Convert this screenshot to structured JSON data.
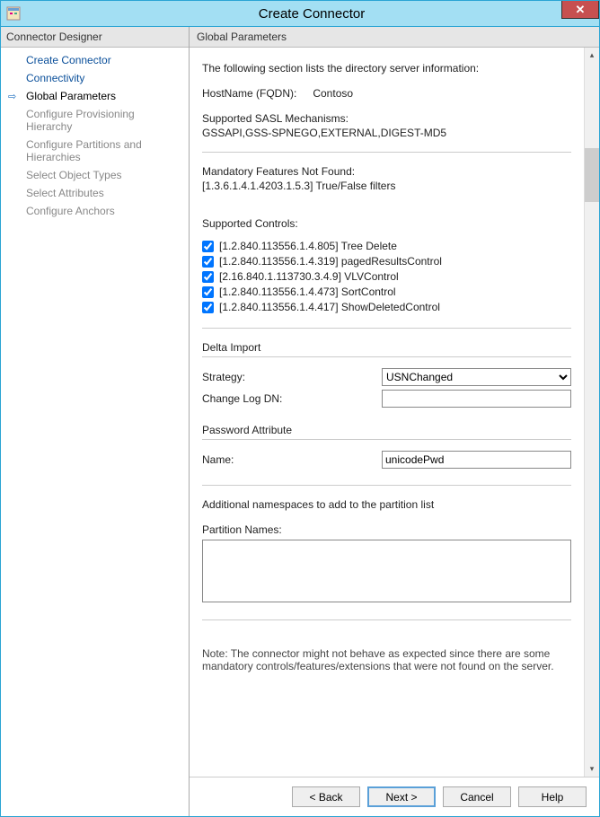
{
  "window": {
    "title": "Create Connector"
  },
  "sidebar": {
    "header": "Connector Designer",
    "items": [
      {
        "label": "Create Connector",
        "state": "enabled"
      },
      {
        "label": "Connectivity",
        "state": "enabled"
      },
      {
        "label": "Global Parameters",
        "state": "current"
      },
      {
        "label": "Configure Provisioning Hierarchy",
        "state": "disabled"
      },
      {
        "label": "Configure Partitions and Hierarchies",
        "state": "disabled"
      },
      {
        "label": "Select Object Types",
        "state": "disabled"
      },
      {
        "label": "Select Attributes",
        "state": "disabled"
      },
      {
        "label": "Configure Anchors",
        "state": "disabled"
      }
    ]
  },
  "main": {
    "header": "Global Parameters",
    "intro": "The following section lists the directory server information:",
    "hostname_label": "HostName (FQDN):",
    "hostname_value": "Contoso",
    "sasl_label": "Supported SASL Mechanisms:",
    "sasl_value": "GSSAPI,GSS-SPNEGO,EXTERNAL,DIGEST-MD5",
    "mandatory_label": "Mandatory Features Not Found:",
    "mandatory_value": "[1.3.6.1.4.1.4203.1.5.3] True/False filters",
    "controls_label": "Supported Controls:",
    "controls": [
      {
        "checked": true,
        "text": "[1.2.840.113556.1.4.805] Tree Delete"
      },
      {
        "checked": true,
        "text": "[1.2.840.113556.1.4.319] pagedResultsControl"
      },
      {
        "checked": true,
        "text": "[2.16.840.1.113730.3.4.9] VLVControl"
      },
      {
        "checked": true,
        "text": "[1.2.840.113556.1.4.473] SortControl"
      },
      {
        "checked": true,
        "text": "[1.2.840.113556.1.4.417] ShowDeletedControl"
      }
    ],
    "delta_header": "Delta Import",
    "strategy_label": "Strategy:",
    "strategy_value": "USNChanged",
    "changelog_label": "Change Log DN:",
    "changelog_value": "",
    "password_header": "Password Attribute",
    "name_label": "Name:",
    "name_value": "unicodePwd",
    "namespaces_intro": "Additional namespaces to add to the partition list",
    "partition_label": "Partition Names:",
    "partition_value": "",
    "note": "Note: The connector might not behave as expected since there are some mandatory controls/features/extensions that were not found on the server."
  },
  "buttons": {
    "back": "<  Back",
    "next": "Next  >",
    "cancel": "Cancel",
    "help": "Help"
  }
}
